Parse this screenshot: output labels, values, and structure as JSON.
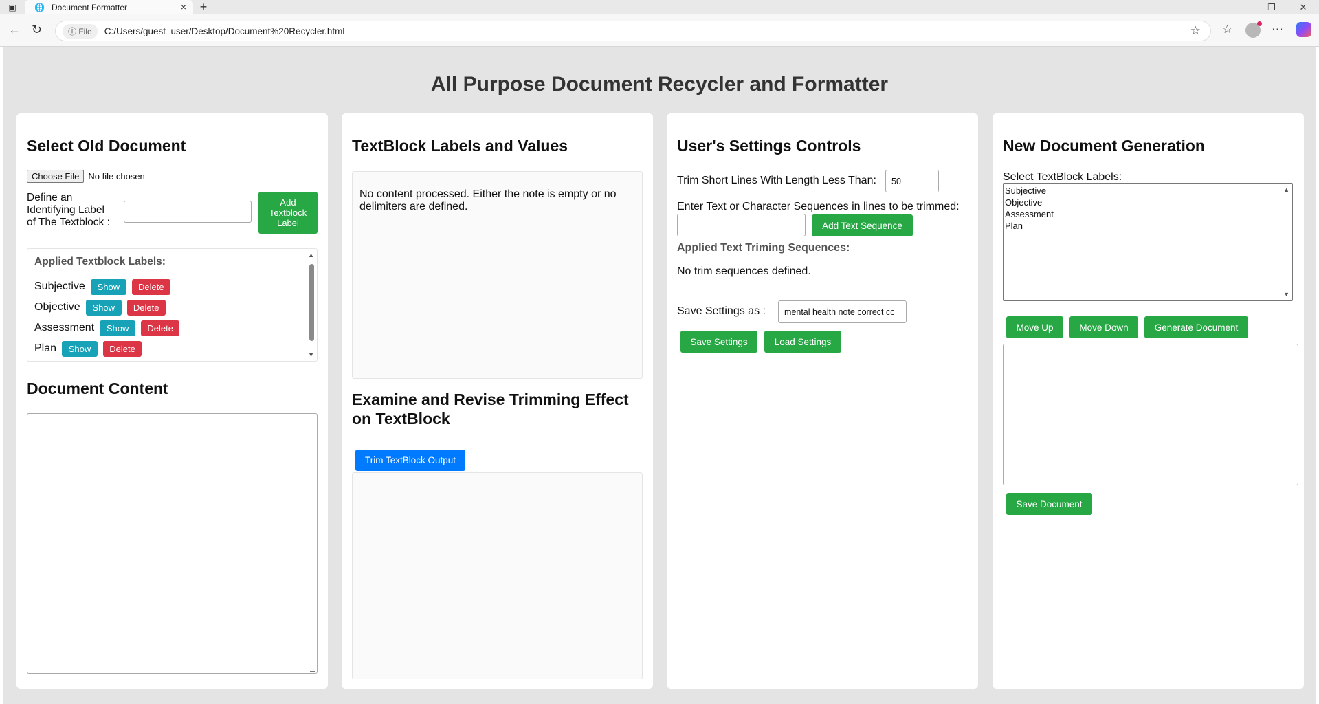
{
  "browser": {
    "tab_title": "Document Formatter",
    "new_tab": "+",
    "info_label": "File",
    "url": "C:/Users/guest_user/Desktop/Document%20Recycler.html"
  },
  "page": {
    "title": "All Purpose Document Recycler and Formatter"
  },
  "select_panel": {
    "heading": "Select Old Document",
    "choose_file": "Choose File",
    "no_file": "No file chosen",
    "label_prompt_1": "Define an",
    "label_prompt_2": "Identifying Label",
    "label_prompt_3": "of The Textblock :",
    "label_input_value": "",
    "add_label_button": "Add Textblock Label",
    "applied_heading": "Applied Textblock Labels:",
    "labels": [
      {
        "name": "Subjective",
        "show": "Show",
        "delete": "Delete"
      },
      {
        "name": "Objective",
        "show": "Show",
        "delete": "Delete"
      },
      {
        "name": "Assessment",
        "show": "Show",
        "delete": "Delete"
      },
      {
        "name": "Plan",
        "show": "Show",
        "delete": "Delete"
      }
    ],
    "content_heading": "Document Content"
  },
  "textblock_panel": {
    "heading": "TextBlock Labels and Values",
    "empty_message": "No content processed. Either the note is empty or no delimiters are defined.",
    "examine_heading": "Examine and Revise Trimming Effect on TextBlock",
    "trim_button": "Trim TextBlock Output"
  },
  "settings_panel": {
    "heading": "User's Settings Controls",
    "trim_label": "Trim Short Lines With Length Less Than:",
    "trim_value": "50",
    "sequence_label": "Enter Text or Character Sequences in lines to be trimmed:",
    "sequence_value": "",
    "add_sequence_button": "Add Text Sequence",
    "applied_heading": "Applied Text Timing Sequences:",
    "applied_heading_actual": "Applied Text Triming Sequences:",
    "no_sequences": "No trim sequences defined.",
    "save_as_label": "Save Settings as :",
    "save_as_value": "mental health note correct cc",
    "save_button": "Save Settings",
    "load_button": "Load Settings"
  },
  "generation_panel": {
    "heading": "New Document Generation",
    "select_label": "Select TextBlock Labels:",
    "options": [
      "Subjective",
      "Objective",
      "Assessment",
      "Plan"
    ],
    "move_up": "Move Up",
    "move_down": "Move Down",
    "generate": "Generate Document",
    "save_document": "Save Document"
  },
  "colors": {
    "green": "#28a745",
    "blue": "#007bff",
    "teal": "#17a2b8",
    "red": "#dc3545",
    "page_bg": "#e4e4e4"
  }
}
